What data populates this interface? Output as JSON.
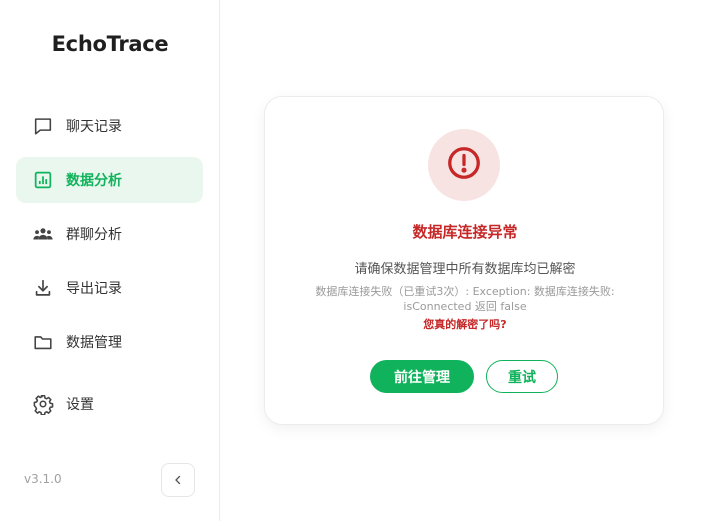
{
  "app": {
    "name": "EchoTrace",
    "version": "v3.1.0"
  },
  "sidebar": {
    "items": [
      {
        "label": "聊天记录",
        "icon": "chat-bubble-icon",
        "active": false
      },
      {
        "label": "数据分析",
        "icon": "bar-chart-icon",
        "active": true
      },
      {
        "label": "群聊分析",
        "icon": "group-icon",
        "active": false
      },
      {
        "label": "导出记录",
        "icon": "download-icon",
        "active": false
      },
      {
        "label": "数据管理",
        "icon": "folder-icon",
        "active": false
      },
      {
        "label": "设置",
        "icon": "gear-icon",
        "active": false
      }
    ],
    "collapse_icon": "chevron-left-icon"
  },
  "error_card": {
    "icon": "alert-circle-icon",
    "title": "数据库连接异常",
    "subtitle": "请确保数据管理中所有数据库均已解密",
    "detail": "数据库连接失败（已重试3次）: Exception: 数据库连接失败: isConnected 返回 false",
    "hint": "您真的解密了吗?",
    "primary_button": "前往管理",
    "secondary_button": "重试"
  },
  "colors": {
    "accent": "#10b35b",
    "accent_bg": "#e9f7ee",
    "error": "#c62828",
    "error_bg": "#f8e3e3"
  }
}
